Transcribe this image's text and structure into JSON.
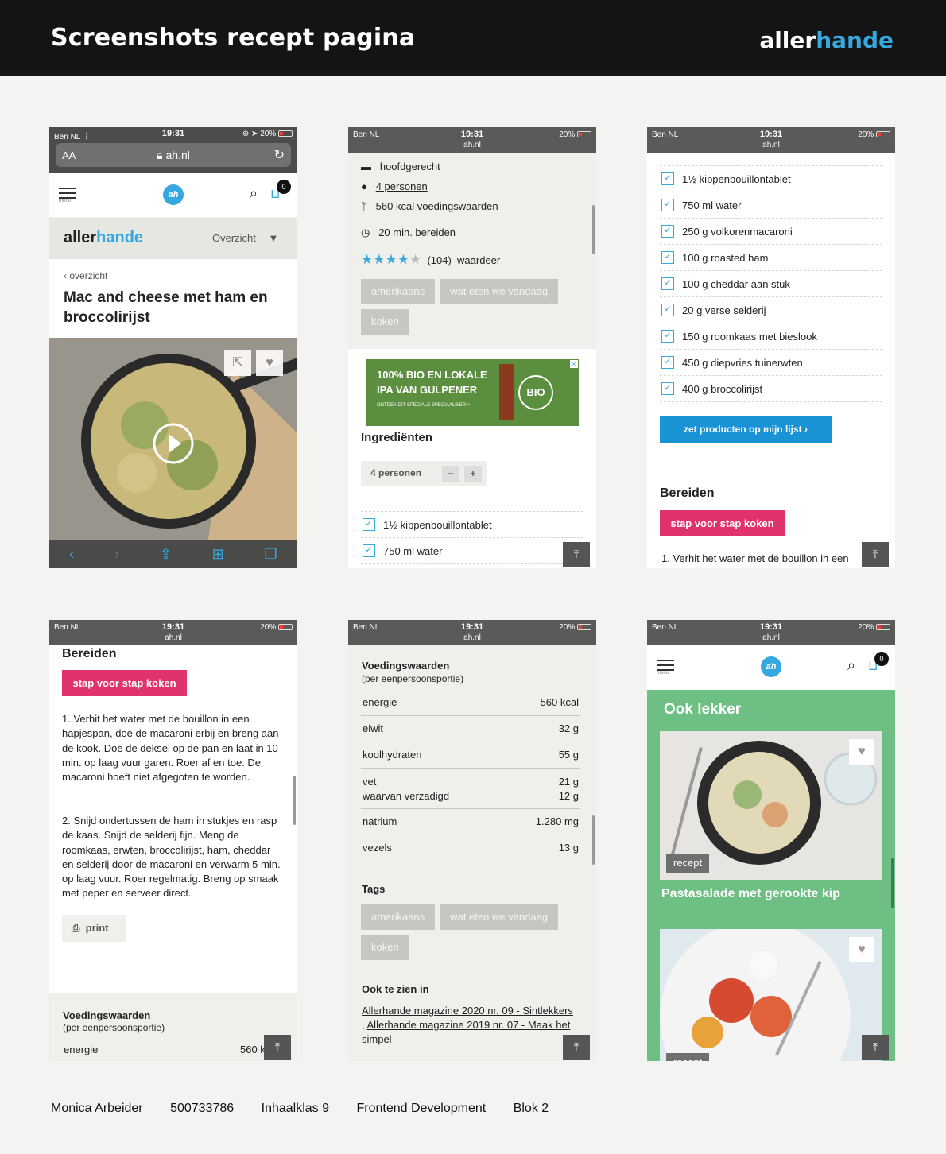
{
  "header": {
    "title": "Screenshots recept pagina",
    "logo_part1": "aller",
    "logo_part2": "hande"
  },
  "status": {
    "carrier": "Ben NL",
    "time": "19:31",
    "battery": "20%",
    "url": "ah.nl"
  },
  "browser": {
    "aa": "AA",
    "url": "ah.nl"
  },
  "site": {
    "menu_label": "menu",
    "cart_count": "0",
    "overview_label": "Overzicht"
  },
  "recipe": {
    "back": "overzicht",
    "title": "Mac and cheese met ham en broccolirijst",
    "course": "hoofdgerecht",
    "persons_link": "4 personen",
    "kcal": "560 kcal",
    "nutrition_link": "voedingswaarden",
    "time": "20 min. bereiden",
    "rating_count": "(104)",
    "rate_link": "waardeer",
    "rating": 4
  },
  "tags": [
    "amerikaans",
    "wat eten we vandaag",
    "koken"
  ],
  "ad": {
    "line1": "100% BIO EN LOKALE",
    "line2": "IPA VAN GULPENER",
    "line3": "ONTDEK DIT SPECIALE SPECIAALBIER >",
    "badge": "BIO"
  },
  "ingredients_title": "Ingrediënten",
  "persons_stepper": {
    "label": "4 personen",
    "minus": "−",
    "plus": "+"
  },
  "ingredients": [
    "1½ kippenbouillontablet",
    "750 ml water",
    "250 g volkorenmacaroni",
    "100 g roasted ham",
    "100 g cheddar aan stuk",
    "20 g verse selderij",
    "150 g roomkaas met bieslook",
    "450 g diepvries tuinerwten",
    "400 g broccolirijst"
  ],
  "add_button": "zet producten op mijn lijst  ›",
  "prepare_title": "Bereiden",
  "step_button": "stap voor stap koken",
  "step1_short": "1. Verhit het water met de bouillon in een",
  "step1": "1. Verhit het water met de bouillon in een hapjespan, doe de macaroni erbij en breng aan de kook. Doe de deksel op de pan en laat in 10 min. op laag vuur garen. Roer af en toe. De macaroni hoeft niet afgegoten te worden.",
  "step2": "2. Snijd ondertussen de ham in stukjes en rasp de kaas. Snijd de selderij fijn. Meng de roomkaas, erwten, broccolirijst, ham, cheddar en selderij door de macaroni en verwarm 5 min. op laag vuur. Roer regelmatig. Breng op smaak met peper en serveer direct.",
  "print": "print",
  "nutrition": {
    "title": "Voedingswaarden",
    "subtitle": "(per eenpersoonsportie)",
    "rows": [
      {
        "label": "energie",
        "value": "560 kcal"
      },
      {
        "label": "eiwit",
        "value": "32 g"
      },
      {
        "label": "koolhydraten",
        "value": "55 g"
      },
      {
        "label": "vet",
        "value": "21 g",
        "label2": "waarvan verzadigd",
        "value2": "12 g"
      },
      {
        "label": "natrium",
        "value": "1.280 mg"
      },
      {
        "label": "vezels",
        "value": "13 g"
      }
    ]
  },
  "tags_title": "Tags",
  "seen_in_title": "Ook te zien in",
  "seen_in_link1": "Allerhande magazine 2020 nr. 09 - Sintlekkers",
  "seen_in_sep": ", ",
  "seen_in_link2a": "Allerhande magazine 2019 nr. 07 - Maak het",
  "seen_in_link2b": "simpel",
  "also_tasty": {
    "title": "Ook lekker",
    "card_badge": "recept",
    "card1_title": "Pastasalade met gerookte kip"
  },
  "footer": [
    "Monica Arbeider",
    "500733786",
    "Inhaalklas 9",
    "Frontend Development",
    "Blok 2"
  ],
  "colors": {
    "blue": "#35a8e0",
    "pink": "#e0336c",
    "green": "#6dbf84",
    "dark": "#141414"
  }
}
